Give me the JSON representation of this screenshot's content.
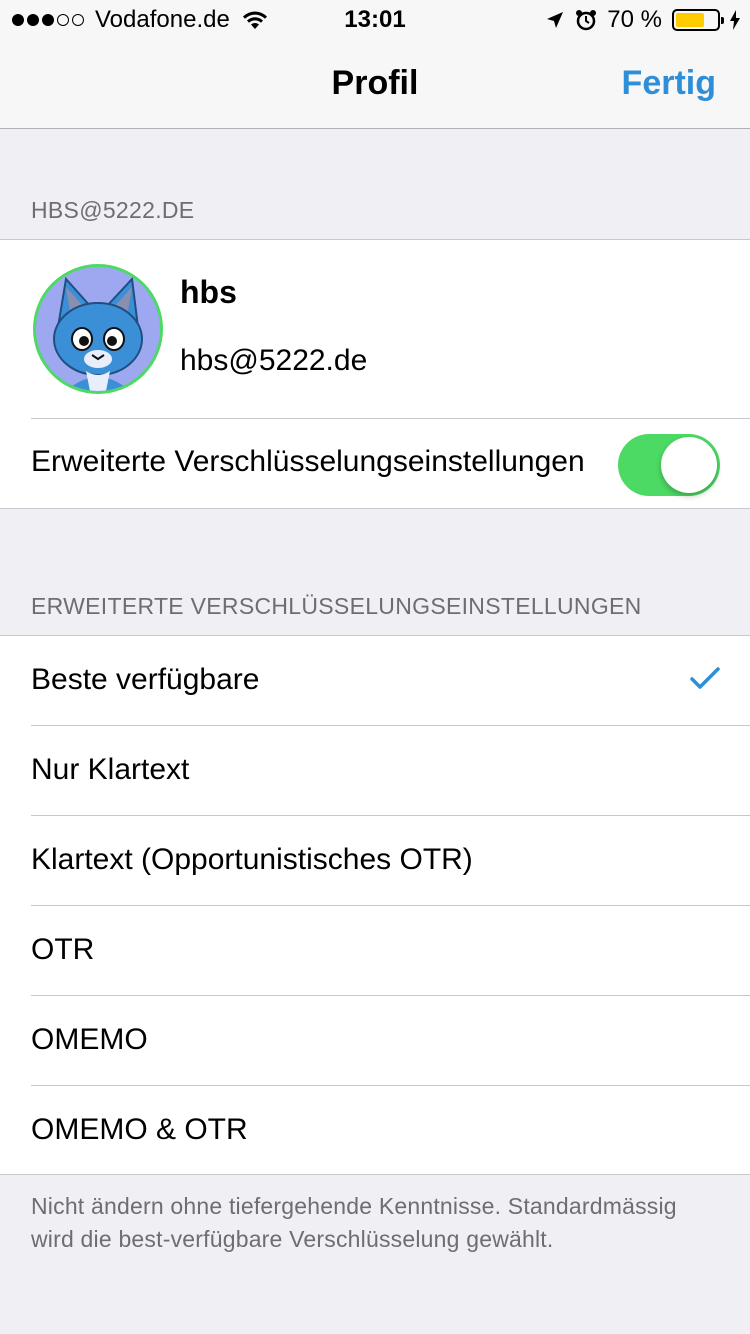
{
  "status_bar": {
    "signal_bars": 5,
    "signal_filled": 3,
    "carrier": "Vodafone.de",
    "time": "13:01",
    "battery_percent": "70 %",
    "battery_level": 0.7,
    "icons": [
      "wifi-icon",
      "location-arrow-icon",
      "alarm-icon",
      "battery-icon",
      "charging-bolt-icon"
    ]
  },
  "nav": {
    "title": "Profil",
    "done": "Fertig"
  },
  "account_section": {
    "header": "HBS@5222.DE",
    "name": "hbs",
    "jid": "hbs@5222.de",
    "toggle_label": "Erweiterte Verschlüsselungseinstellungen",
    "toggle_on": true
  },
  "encryption_section": {
    "header": "ERWEITERTE VERSCHLÜSSELUNGSEINSTELLUNGEN",
    "options": [
      {
        "label": "Beste verfügbare",
        "selected": true
      },
      {
        "label": "Nur Klartext",
        "selected": false
      },
      {
        "label": "Klartext (Opportunistisches OTR)",
        "selected": false
      },
      {
        "label": "OTR",
        "selected": false
      },
      {
        "label": "OMEMO",
        "selected": false
      },
      {
        "label": "OMEMO & OTR",
        "selected": false
      }
    ],
    "footer": "Nicht ändern ohne tiefergehende Kenntnisse. Standardmässig wird die best-verfügbare Verschlüsselung gewählt."
  },
  "colors": {
    "accent": "#2f8ed8",
    "switch_on": "#4cd964",
    "background": "#efeff4",
    "battery": "#ffcc00"
  }
}
